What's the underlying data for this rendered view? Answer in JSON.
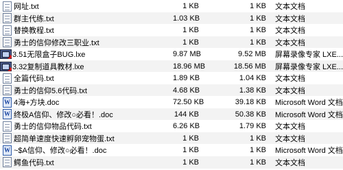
{
  "files": [
    {
      "name": "网址.txt",
      "size": "1 KB",
      "compressed": "1 KB",
      "type": "文本文档",
      "icon": "text-file-icon"
    },
    {
      "name": "群主代练.txt",
      "size": "1.03 KB",
      "compressed": "1 KB",
      "type": "文本文档",
      "icon": "text-file-icon"
    },
    {
      "name": "替换教程.txt",
      "size": "1 KB",
      "compressed": "1 KB",
      "type": "文本文档",
      "icon": "text-file-icon"
    },
    {
      "name": "勇士的信仰修改三职业.txt",
      "size": "1 KB",
      "compressed": "1 KB",
      "type": "文本文档",
      "icon": "text-file-icon"
    },
    {
      "name": "3.51无限盒子BUG.lxe",
      "size": "9.87 MB",
      "compressed": "9.52 MB",
      "type": "屏幕录像专家 LXE...",
      "icon": "lxe-video-icon"
    },
    {
      "name": "3.32复制道具教材.lxe",
      "size": "18.96 MB",
      "compressed": "18.56 MB",
      "type": "屏幕录像专家 LXE...",
      "icon": "lxe-video-icon"
    },
    {
      "name": "全篇代码.txt",
      "size": "1.89 KB",
      "compressed": "1.04 KB",
      "type": "文本文档",
      "icon": "text-file-icon"
    },
    {
      "name": "勇士的信仰5.6代码.txt",
      "size": "4.68 KB",
      "compressed": "1.38 KB",
      "type": "文本文档",
      "icon": "text-file-icon"
    },
    {
      "name": "4海+方块.doc",
      "size": "72.50 KB",
      "compressed": "39.18 KB",
      "type": "Microsoft Word 文档",
      "icon": "word-doc-icon"
    },
    {
      "name": "终极A信仰、修改○必看！.doc",
      "size": "144 KB",
      "compressed": "50.38 KB",
      "type": "Microsoft Word 文档",
      "icon": "word-doc-icon"
    },
    {
      "name": "勇士的信仰物品代码.txt",
      "size": "6.26 KB",
      "compressed": "1.79 KB",
      "type": "文本文档",
      "icon": "text-file-icon"
    },
    {
      "name": "超简单速度快速孵卵宠物蛋.txt",
      "size": "1 KB",
      "compressed": "1 KB",
      "type": "文本文档",
      "icon": "text-file-icon"
    },
    {
      "name": "~$A信仰、修改○必看！.doc",
      "size": "1 KB",
      "compressed": "1 KB",
      "type": "Microsoft Word 文档",
      "icon": "word-doc-icon"
    },
    {
      "name": "鳄鱼代码.txt",
      "size": "1 KB",
      "compressed": "1 KB",
      "type": "文本文档",
      "icon": "text-file-icon"
    }
  ]
}
